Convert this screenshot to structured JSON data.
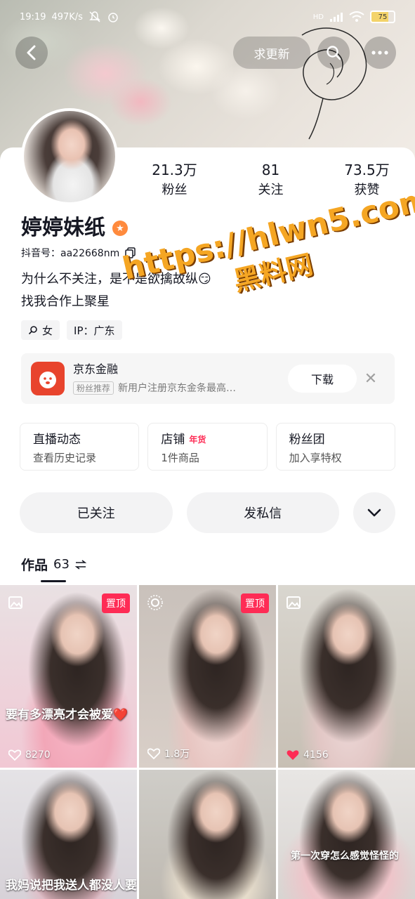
{
  "status_bar": {
    "time": "19:19",
    "speed": "497K/s",
    "network": "HD",
    "battery": "75"
  },
  "header": {
    "refresh_label": "求更新"
  },
  "profile": {
    "name": "婷婷妹纸",
    "uid": "抖音号：aa22668nm",
    "bio_line1": "为什么不关注，是不是欲擒故纵😏",
    "bio_line2": "找我合作上聚星",
    "tags": {
      "gender": "女",
      "ip": "IP：广东"
    }
  },
  "stats": [
    {
      "value": "21.3万",
      "label": "粉丝"
    },
    {
      "value": "81",
      "label": "关注"
    },
    {
      "value": "73.5万",
      "label": "获赞"
    }
  ],
  "ad": {
    "title": "京东金融",
    "chip": "粉丝推荐",
    "subtitle": "新用户注册京东金条最高…",
    "button": "下载"
  },
  "features": [
    {
      "title": "直播动态",
      "sub": "查看历史记录",
      "hot": ""
    },
    {
      "title": "店铺",
      "sub": "1件商品",
      "hot": "年货"
    },
    {
      "title": "粉丝团",
      "sub": "加入享特权",
      "hot": ""
    }
  ],
  "actions": {
    "followed": "已关注",
    "message": "发私信"
  },
  "tab": {
    "label": "作品",
    "count": "63"
  },
  "videos": [
    {
      "pin": "置顶",
      "caption": "要有多漂亮才会被爱❤️",
      "likes": "8270"
    },
    {
      "pin": "置顶",
      "caption": "",
      "likes": "1.8万"
    },
    {
      "pin": "",
      "caption": "",
      "likes": "4156"
    },
    {
      "pin": "",
      "caption": "我妈说把我送人都没人要",
      "likes": ""
    },
    {
      "pin": "",
      "caption": "",
      "likes": ""
    },
    {
      "pin": "",
      "caption": "第一次穿怎么感觉怪怪的",
      "likes": ""
    }
  ],
  "watermark": {
    "url": "https://hlwn5.com",
    "name": "黑料网"
  },
  "colors": {
    "accent": "#fe2c55",
    "text": "#161823",
    "watermark": "#f5a623"
  }
}
